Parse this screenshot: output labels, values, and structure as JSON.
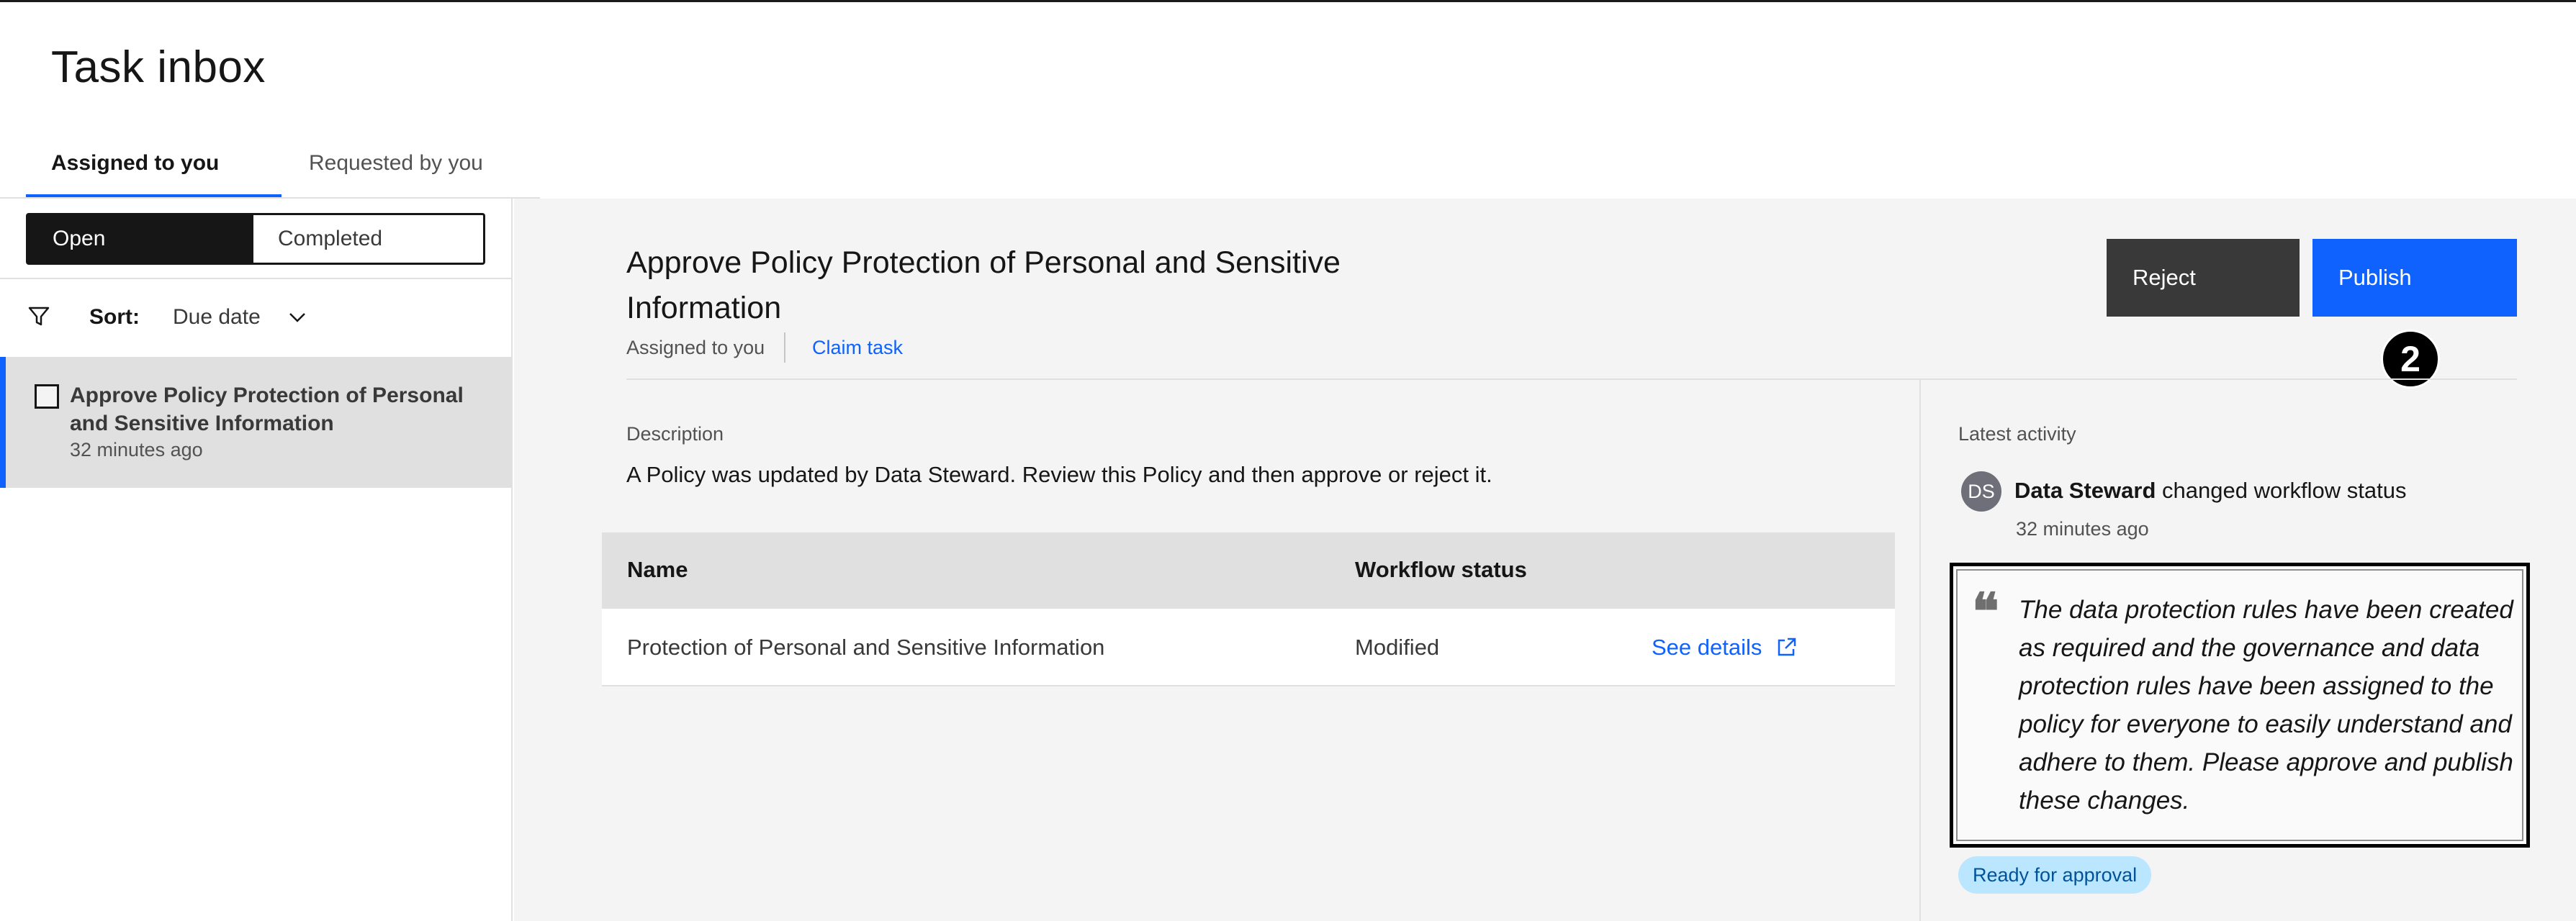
{
  "page": {
    "title": "Task inbox"
  },
  "tabs": [
    {
      "label": "Assigned to you",
      "active": true
    },
    {
      "label": "Requested by you",
      "active": false
    }
  ],
  "filter": {
    "open_label": "Open",
    "completed_label": "Completed",
    "sort_label": "Sort:",
    "sort_value": "Due date"
  },
  "task_list": [
    {
      "title": "Approve Policy Protection of Personal and Sensitive Information",
      "time": "32 minutes ago",
      "selected": true
    }
  ],
  "task": {
    "heading": "Approve Policy Protection of Personal and Sensitive Information",
    "assigned": "Assigned to you",
    "claim_label": "Claim task",
    "reject_label": "Reject",
    "publish_label": "Publish",
    "step_number": "2",
    "description_label": "Description",
    "description": "A Policy was updated by Data Steward. Review this Policy and then approve or reject it."
  },
  "table": {
    "headers": [
      "Name",
      "Workflow status"
    ],
    "rows": [
      {
        "name": "Protection of Personal and Sensitive Information",
        "status": "Modified",
        "link": "See details"
      }
    ]
  },
  "activity": {
    "label": "Latest activity",
    "avatar_initials": "DS",
    "actor": "Data Steward",
    "action": "changed workflow status",
    "time": "32 minutes ago",
    "comment": "The data protection rules have been created as required and the governance and data protection rules have been assigned to the policy for everyone to easily understand and adhere to them. Please approve and publish these changes.",
    "status_tag": "Ready for approval"
  },
  "colors": {
    "accent": "#0f62fe",
    "dark_button": "#393939",
    "tag_bg": "#bae6ff",
    "tag_text": "#00539a"
  },
  "icons": [
    "filter-icon",
    "chevron-down-icon",
    "external-link-icon",
    "quote-icon"
  ]
}
